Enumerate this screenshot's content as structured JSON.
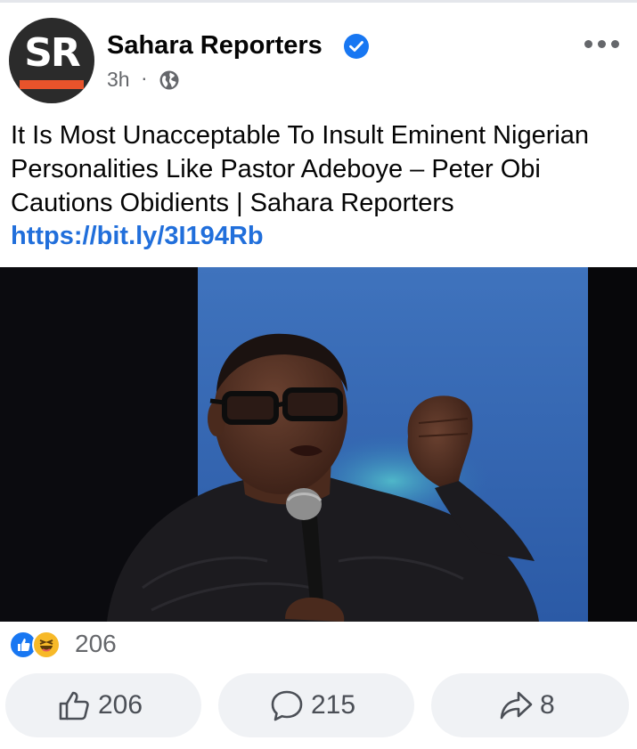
{
  "post": {
    "page_name": "Sahara Reporters",
    "avatar_text": "SR",
    "time": "3h",
    "separator": "·",
    "audience_icon": "globe-icon",
    "verified_icon": "verified-badge-icon",
    "more_icon": "more-options-icon",
    "text": "It Is Most Unacceptable To Insult Eminent Nigerian Personalities Like Pastor Adeboye – Peter Obi Cautions Obidients | Sahara Reporters",
    "link": "https://bit.ly/3I194Rb"
  },
  "reactions": {
    "icons": [
      "like-reaction-icon",
      "haha-reaction-icon"
    ],
    "count": "206"
  },
  "actions": {
    "like_count": "206",
    "comment_count": "215",
    "share_count": "8"
  },
  "colors": {
    "accent": "#1877f2",
    "link": "#216fdb",
    "secondary_text": "#65676b",
    "button_bg": "#f0f2f5",
    "avatar_bg": "#2b2b2b",
    "avatar_bar": "#e8532b"
  }
}
